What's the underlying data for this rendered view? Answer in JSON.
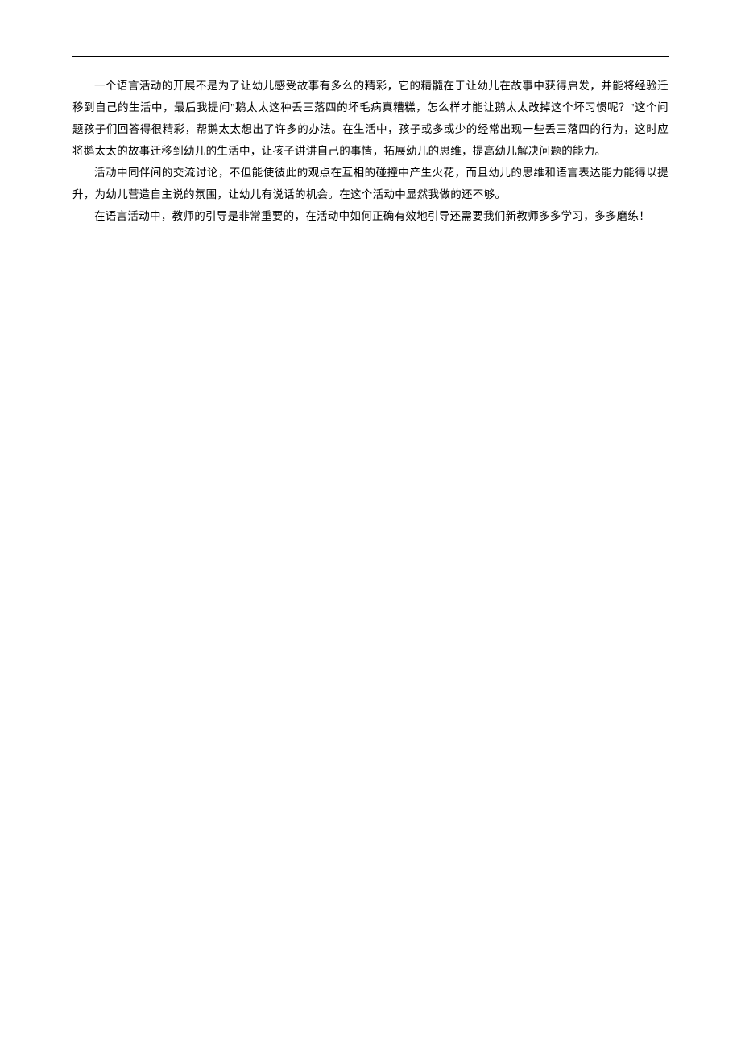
{
  "paragraphs": [
    "一个语言活动的开展不是为了让幼儿感受故事有多么的精彩，它的精髓在于让幼儿在故事中获得启发，并能将经验迁移到自己的生活中，最后我提问\"鹅太太这种丢三落四的坏毛病真糟糕，怎么样才能让鹅太太改掉这个坏习惯呢？\"这个问题孩子们回答得很精彩，帮鹅太太想出了许多的办法。在生活中，孩子或多或少的经常出现一些丢三落四的行为，这时应将鹅太太的故事迁移到幼儿的生活中，让孩子讲讲自己的事情，拓展幼儿的思维，提高幼儿解决问题的能力。",
    "活动中同伴间的交流讨论，不但能使彼此的观点在互相的碰撞中产生火花，而且幼儿的思维和语言表达能力能得以提升，为幼儿营造自主说的氛围，让幼儿有说话的机会。在这个活动中显然我做的还不够。",
    "在语言活动中，教师的引导是非常重要的，在活动中如何正确有效地引导还需要我们新教师多多学习，多多磨练！"
  ]
}
